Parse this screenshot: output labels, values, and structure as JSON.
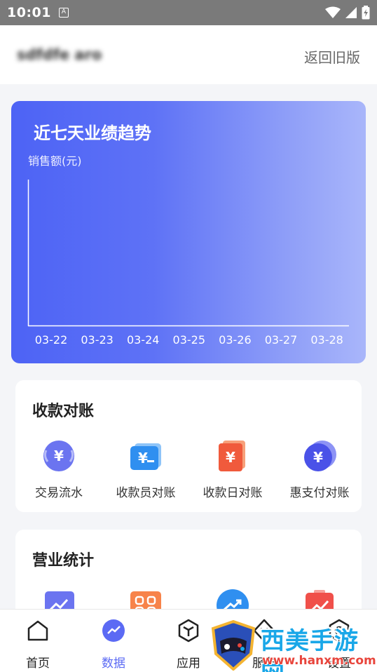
{
  "status_bar": {
    "time": "10:01",
    "notification_glyph": "A"
  },
  "header": {
    "store_name": "sdfdfe aro",
    "back_old_label": "返回旧版"
  },
  "trend": {
    "title": "近七天业绩趋势",
    "ylabel": "销售额(元)"
  },
  "chart_data": {
    "type": "line",
    "title": "近七天业绩趋势",
    "ylabel": "销售额(元)",
    "xlabel": "",
    "categories": [
      "03-22",
      "03-23",
      "03-24",
      "03-25",
      "03-26",
      "03-27",
      "03-28"
    ],
    "series": [],
    "grid": false,
    "legend": "none"
  },
  "reconcile": {
    "title": "收款对账",
    "items": [
      {
        "label": "交易流水",
        "icon": "transaction-flow-icon",
        "color": "#6b74f0"
      },
      {
        "label": "收款员对账",
        "icon": "cashier-reconcile-icon",
        "color": "#2f8ff0"
      },
      {
        "label": "收款日对账",
        "icon": "daily-reconcile-icon",
        "color": "#f05a3c"
      },
      {
        "label": "惠支付对账",
        "icon": "hui-pay-reconcile-icon",
        "color": "#4a52e8"
      }
    ]
  },
  "business": {
    "title": "营业统计",
    "items": [
      {
        "icon": "sales-chart-icon",
        "color": "#6b74f0"
      },
      {
        "icon": "grid-stats-icon",
        "color": "#f7834a"
      },
      {
        "icon": "growth-trend-icon",
        "color": "#2f8ff0"
      },
      {
        "icon": "clipboard-chart-icon",
        "color": "#f0504a"
      }
    ]
  },
  "bottom_nav": {
    "items": [
      {
        "label": "首页",
        "icon": "home-icon"
      },
      {
        "label": "数据",
        "icon": "data-icon"
      },
      {
        "label": "应用",
        "icon": "apps-icon"
      },
      {
        "label": "服务",
        "icon": "service-icon"
      },
      {
        "label": "设置",
        "icon": "settings-icon"
      }
    ],
    "active_index": 1,
    "active_color": "#5b6af4"
  },
  "watermark": {
    "text": "西美手游网",
    "url": "www.hanxm.com"
  }
}
